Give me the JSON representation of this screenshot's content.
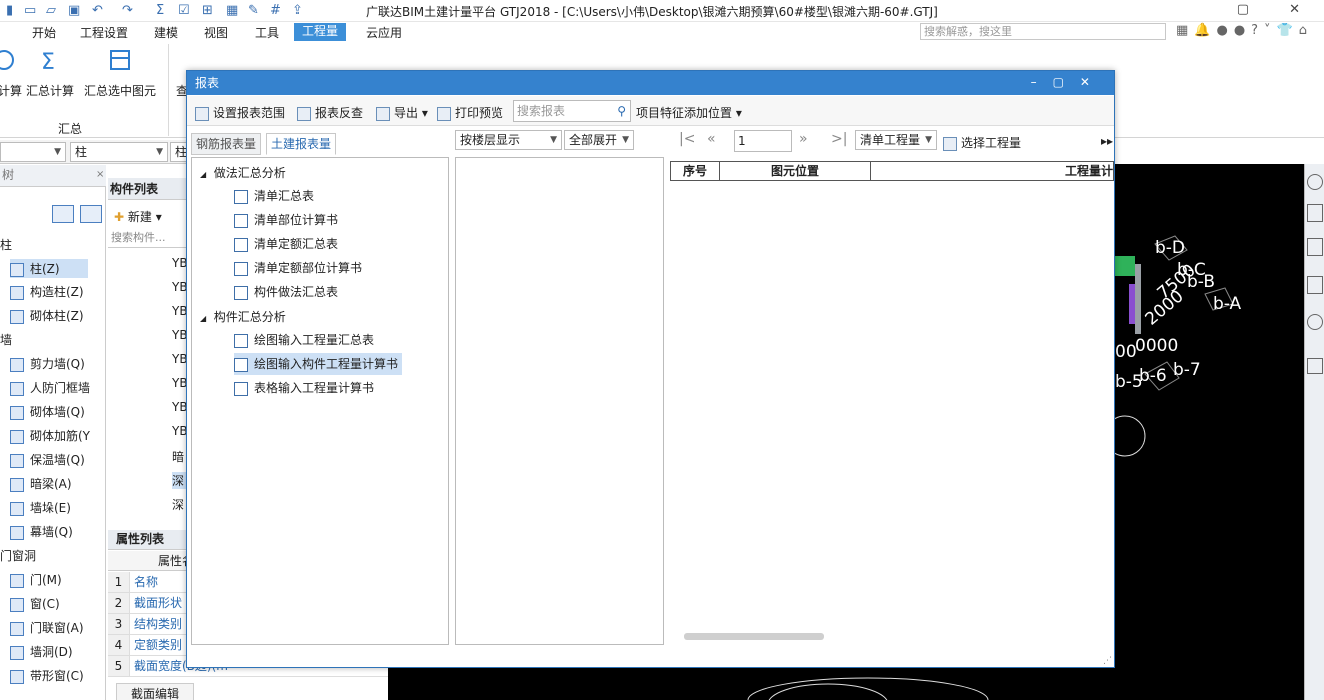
{
  "title_bar": {
    "title": "广联达BIM土建计量平台 GTJ2018 - [C:\\Users\\小伟\\Desktop\\银滩六期预算\\60#楼型\\银滩六期-60#.GTJ]"
  },
  "menu": {
    "items": [
      "开始",
      "工程设置",
      "建模",
      "视图",
      "工具",
      "工程量",
      "云应用"
    ],
    "active": "工程量",
    "search_placeholder": "搜索解惑，搜这里"
  },
  "ribbon": {
    "buttons": [
      "计算",
      "汇总计算",
      "汇总选中图元",
      "查"
    ],
    "group_label": "汇总"
  },
  "combos": {
    "first": "",
    "second": "柱",
    "third": "柱"
  },
  "left_panel": {
    "header": "树",
    "category_cols": "柱",
    "category_walls": "墙",
    "category_doors": "门窗洞",
    "items": [
      {
        "label": "柱(Z)",
        "icon": "column-icon",
        "selected": true
      },
      {
        "label": "构造柱(Z)",
        "icon": "construct-column-icon"
      },
      {
        "label": "砌体柱(Z)",
        "icon": "masonry-column-icon"
      },
      {
        "label": "剪力墙(Q)",
        "icon": "shear-wall-icon"
      },
      {
        "label": "人防门框墙",
        "icon": "civil-defense-wall-icon"
      },
      {
        "label": "砌体墙(Q)",
        "icon": "masonry-wall-icon"
      },
      {
        "label": "砌体加筋(Y",
        "icon": "masonry-rebar-icon"
      },
      {
        "label": "保温墙(Q)",
        "icon": "insulation-wall-icon"
      },
      {
        "label": "暗梁(A)",
        "icon": "hidden-beam-icon"
      },
      {
        "label": "墙垛(E)",
        "icon": "wall-pier-icon"
      },
      {
        "label": "幕墙(Q)",
        "icon": "curtain-wall-icon"
      },
      {
        "label": "门(M)",
        "icon": "door-icon"
      },
      {
        "label": "窗(C)",
        "icon": "window-icon"
      },
      {
        "label": "门联窗(A)",
        "icon": "door-window-icon"
      },
      {
        "label": "墙洞(D)",
        "icon": "wall-hole-icon"
      },
      {
        "label": "带形窗(C)",
        "icon": "strip-window-icon"
      }
    ]
  },
  "component_list": {
    "tab": "构件列表",
    "new_label": "新建",
    "search_placeholder": "搜索构件...",
    "rows": [
      "YB",
      "YB",
      "YB",
      "YB",
      "YB",
      "YB",
      "YB",
      "YB",
      "暗",
      "深",
      "深"
    ]
  },
  "property_list": {
    "tab": "属性列表",
    "col_header": "属性名",
    "rows": [
      {
        "no": "1",
        "name": "名称"
      },
      {
        "no": "2",
        "name": "截面形状"
      },
      {
        "no": "3",
        "name": "结构类别"
      },
      {
        "no": "4",
        "name": "定额类别"
      },
      {
        "no": "5",
        "name": "截面宽度(B边)(m"
      }
    ],
    "bottom_tab": "截面编辑"
  },
  "dialog": {
    "title": "报表",
    "toolbar": {
      "set_range": "设置报表范围",
      "reverse_check": "报表反查",
      "export": "导出",
      "print_preview": "打印预览",
      "search_placeholder": "搜索报表",
      "add_position": "项目特征添加位置"
    },
    "tabs": [
      "钢筋报表量",
      "土建报表量"
    ],
    "active_tab": "土建报表量",
    "tree": [
      {
        "group": "做法汇总分析",
        "items": [
          "清单汇总表",
          "清单部位计算书",
          "清单定额汇总表",
          "清单定额部位计算书",
          "构件做法汇总表"
        ]
      },
      {
        "group": "构件汇总分析",
        "items": [
          "绘图输入工程量汇总表",
          "绘图输入构件工程量计算书",
          "表格输入工程量计算书"
        ]
      }
    ],
    "selected_item": "绘图输入构件工程量计算书",
    "floor_combo": "按楼层显示",
    "expand_combo": "全部展开",
    "page": "1",
    "qty_combo": "清单工程量",
    "select_qty": "选择工程量",
    "table_headers": [
      "序号",
      "图元位置",
      "工程量计"
    ]
  },
  "viewport": {
    "labels": [
      "b-D",
      "7500",
      "b-C",
      "b-B",
      "b-A",
      "2000",
      "00",
      "0000",
      "b-5",
      "b-6",
      "b-7"
    ]
  }
}
